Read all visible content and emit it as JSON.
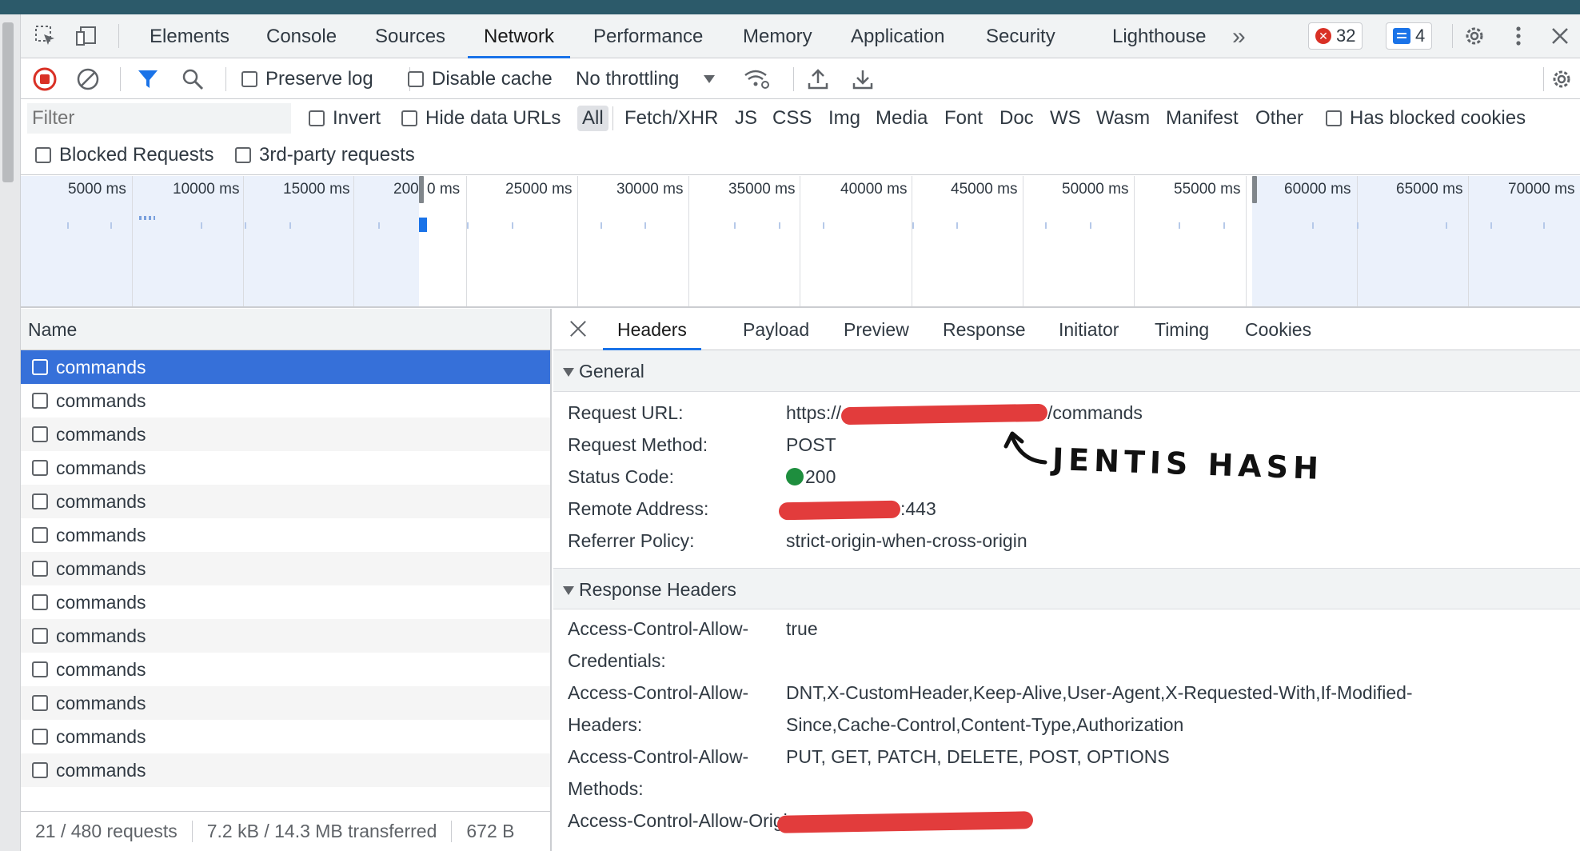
{
  "devtools_tabs": [
    "Elements",
    "Console",
    "Sources",
    "Network",
    "Performance",
    "Memory",
    "Application",
    "Security",
    "Lighthouse"
  ],
  "active_tab": "Network",
  "more_tabs_glyph": "»",
  "error_count": "32",
  "message_count": "4",
  "toolbar": {
    "preserve_log": "Preserve log",
    "disable_cache": "Disable cache",
    "throttling": "No throttling"
  },
  "filter": {
    "placeholder": "Filter",
    "invert": "Invert",
    "hide_data_urls": "Hide data URLs",
    "types": [
      "All",
      "Fetch/XHR",
      "JS",
      "CSS",
      "Img",
      "Media",
      "Font",
      "Doc",
      "WS",
      "Wasm",
      "Manifest",
      "Other"
    ],
    "has_blocked_cookies": "Has blocked cookies",
    "blocked_requests": "Blocked Requests",
    "third_party": "3rd-party requests"
  },
  "timeline_labels": [
    "5000 ms",
    "10000 ms",
    "15000 ms",
    "200",
    "0 ms",
    "25000 ms",
    "30000 ms",
    "35000 ms",
    "40000 ms",
    "45000 ms",
    "50000 ms",
    "55000 ms",
    "60000 ms",
    "65000 ms",
    "70000 ms"
  ],
  "request_list": {
    "header": "Name",
    "rows": [
      "commands",
      "commands",
      "commands",
      "commands",
      "commands",
      "commands",
      "commands",
      "commands",
      "commands",
      "commands",
      "commands",
      "commands",
      "commands"
    ]
  },
  "status_bar": {
    "requests": "21 / 480 requests",
    "transferred": "7.2 kB / 14.3 MB transferred",
    "resources": "672 B"
  },
  "detail_tabs": [
    "Headers",
    "Payload",
    "Preview",
    "Response",
    "Initiator",
    "Timing",
    "Cookies"
  ],
  "general": {
    "title": "General",
    "request_url_label": "Request URL:",
    "request_url_prefix": "https://",
    "request_url_suffix": "/commands",
    "request_method_label": "Request Method:",
    "request_method": "POST",
    "status_code_label": "Status Code:",
    "status_code": "200",
    "remote_address_label": "Remote Address:",
    "remote_address_suffix": ":443",
    "referrer_policy_label": "Referrer Policy:",
    "referrer_policy": "strict-origin-when-cross-origin"
  },
  "response_headers": {
    "title": "Response Headers",
    "acac_label_1": "Access-Control-Allow-",
    "acac_label_2": "Credentials:",
    "acac_value": "true",
    "acah_label_1": "Access-Control-Allow-",
    "acah_label_2": "Headers:",
    "acah_value_1": "DNT,X-CustomHeader,Keep-Alive,User-Agent,X-Requested-With,If-Modified-",
    "acah_value_2": "Since,Cache-Control,Content-Type,Authorization",
    "acam_label_1": "Access-Control-Allow-",
    "acam_label_2": "Methods:",
    "acam_value": "PUT, GET, PATCH, DELETE, POST, OPTIONS",
    "acao_label": "Access-Control-Allow-Origin:"
  },
  "annotation": "JENTIS  HASH"
}
